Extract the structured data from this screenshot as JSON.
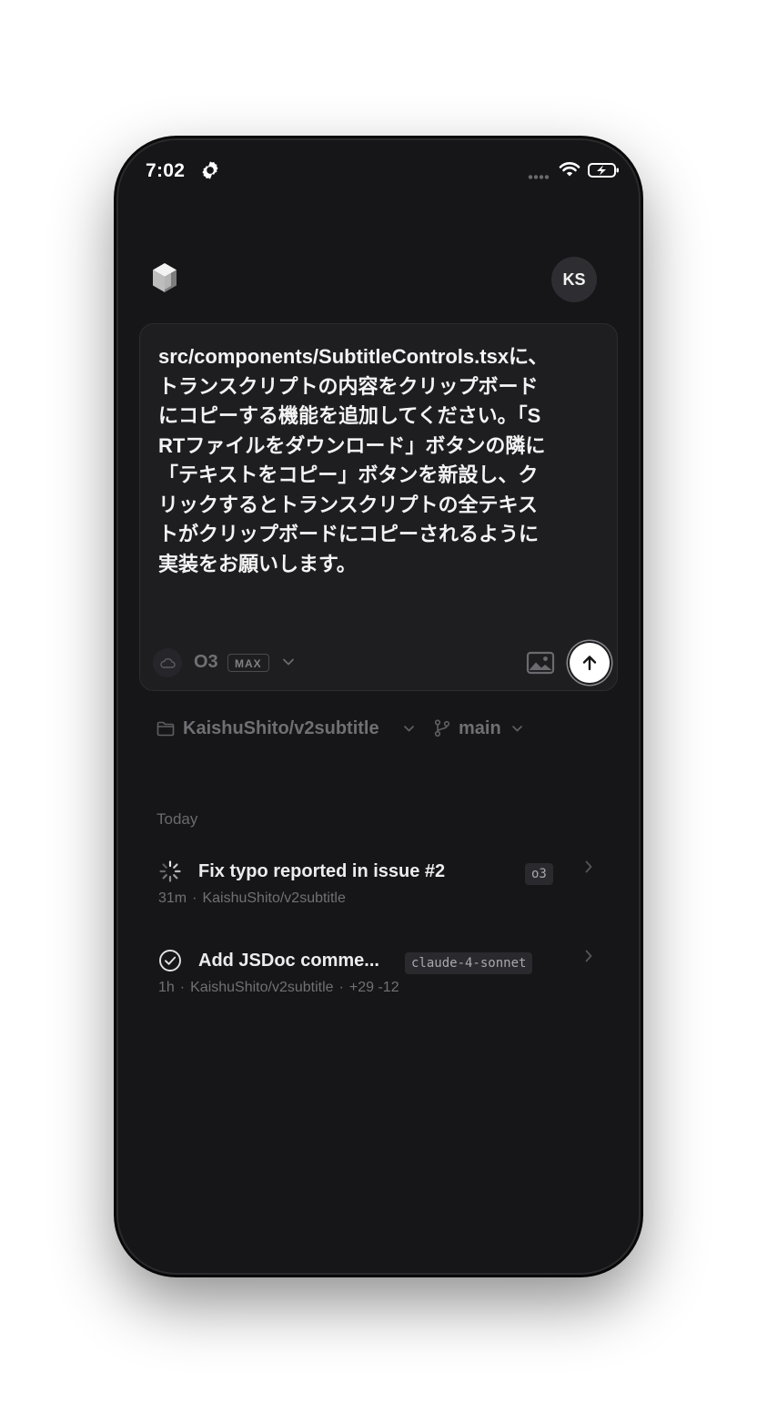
{
  "status_bar": {
    "time": "7:02"
  },
  "header": {
    "avatar_initials": "KS"
  },
  "composer": {
    "prompt_text": "src/components/SubtitleControls.tsxに、トランスクリプトの内容をクリップボードにコピーする機能を追加してください。「SRTファイルをダウンロード」ボタンの隣に「テキストをコピー」ボタンを新設し、クリックするとトランスクリプトの全テキストがクリップボードにコピーされるように実装をお願いします。",
    "model": "O3",
    "model_badge": "MAX"
  },
  "repo_bar": {
    "repository": "KaishuShito/v2subtitle",
    "branch": "main"
  },
  "tasks_section": {
    "label": "Today",
    "items": [
      {
        "title": "Fix typo reported in issue #2",
        "model": "o3",
        "age": "31m",
        "repo": "KaishuShito/v2subtitle",
        "status": "in-progress"
      },
      {
        "title": "Add JSDoc comme...",
        "model": "claude-4-sonnet",
        "age": "1h",
        "repo": "KaishuShito/v2subtitle",
        "diff": "+29 -12",
        "status": "completed"
      }
    ]
  },
  "colors": {
    "background": "#161618",
    "composer_bg": "#1e1e21",
    "text_primary": "#ececef",
    "text_muted": "#707074"
  }
}
